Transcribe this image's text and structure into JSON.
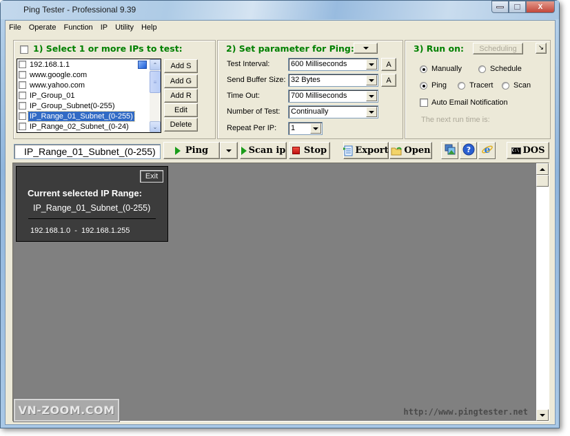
{
  "window": {
    "title": "Ping Tester - Professional  9.39",
    "controls": {
      "minimize": "—",
      "maximize": "▫",
      "close": "X"
    }
  },
  "menu": [
    "File",
    "Operate",
    "Function",
    "IP",
    "Utility",
    "Help"
  ],
  "section1": {
    "heading": "1) Select 1 or more IPs to test:",
    "select_all_checked": false,
    "items": [
      {
        "label": "192.168.1.1",
        "checked": false,
        "selected": false
      },
      {
        "label": "www.google.com",
        "checked": false,
        "selected": false
      },
      {
        "label": "www.yahoo.com",
        "checked": false,
        "selected": false
      },
      {
        "label": "IP_Group_01",
        "checked": false,
        "selected": false
      },
      {
        "label": "IP_Group_Subnet(0-255)",
        "checked": false,
        "selected": false
      },
      {
        "label": "IP_Range_01_Subnet_(0-255)",
        "checked": false,
        "selected": true
      },
      {
        "label": "IP_Range_02_Subnet_(0-24)",
        "checked": false,
        "selected": false
      }
    ],
    "buttons": {
      "add_s": "Add S",
      "add_g": "Add G",
      "add_r": "Add R",
      "edit": "Edit",
      "delete": "Delete"
    }
  },
  "section2": {
    "heading": "2) Set parameter for Ping:",
    "fields": {
      "test_interval": {
        "label": "Test Interval:",
        "value": "600  Milliseconds",
        "aux": "A"
      },
      "send_buffer_size": {
        "label": "Send Buffer Size:",
        "value": "32  Bytes",
        "aux": "A"
      },
      "time_out": {
        "label": "Time Out:",
        "value": "700  Milliseconds"
      },
      "number_of_test": {
        "label": "Number of Test:",
        "value": "Continually"
      },
      "repeat_per_ip": {
        "label": "Repeat Per IP:",
        "value": "1"
      }
    }
  },
  "section3": {
    "heading": "3) Run on:",
    "scheduling_button": "Scheduling",
    "run_mode": {
      "manually": "Manually",
      "schedule": "Schedule",
      "selected": "Manually"
    },
    "test_type": {
      "ping": "Ping",
      "tracert": "Tracert",
      "scan": "Scan",
      "selected": "Ping"
    },
    "auto_email": {
      "label": "Auto Email Notification",
      "checked": false
    },
    "next_run_label": "The next run time is:"
  },
  "toolbar": {
    "current_target": "IP_Range_01_Subnet_(0-255)",
    "ping": "Ping",
    "scan_ip": "Scan ip",
    "stop": "Stop",
    "export": "Export",
    "open": "Open",
    "dos": "DOS"
  },
  "popup": {
    "exit": "Exit",
    "heading": "Current selected IP Range:",
    "range_name": "IP_Range_01_Subnet_(0-255)",
    "range_span": "192.168.1.0  -  192.168.1.255"
  },
  "footer": {
    "watermark": "VN-ZOOM.COM",
    "url": "http://www.pingtester.net"
  },
  "colors": {
    "heading_green": "#008000",
    "selection_blue": "#316ac5",
    "output_bg": "#808080",
    "popup_bg": "#3c3c3c"
  }
}
